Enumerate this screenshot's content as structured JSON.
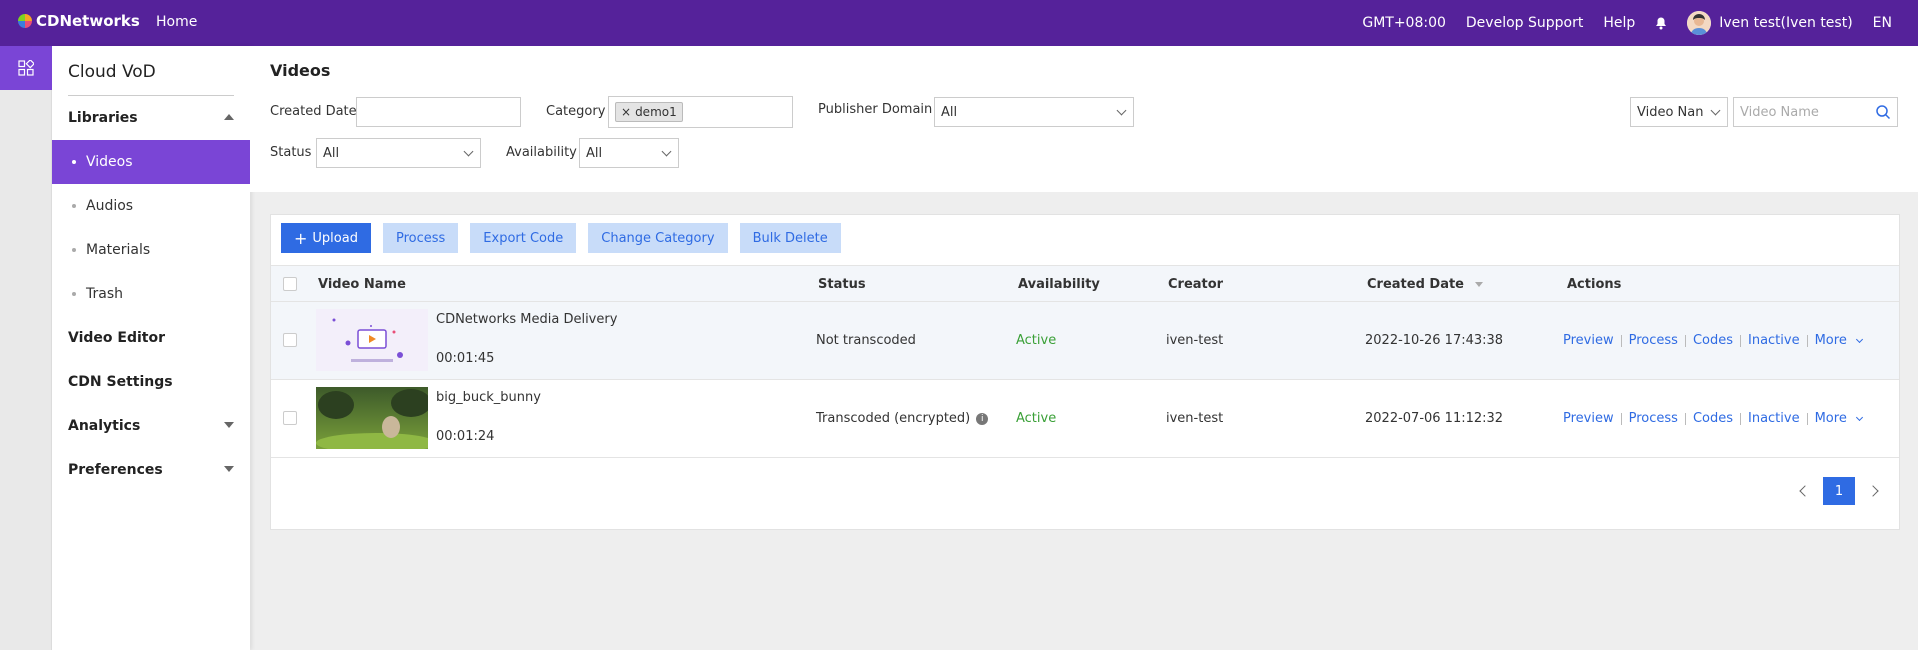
{
  "topbar": {
    "brand": "CDNetworks",
    "home": "Home",
    "timezone": "GMT+08:00",
    "develop_support": "Develop Support",
    "help": "Help",
    "user": "Iven test(Iven test)",
    "lang": "EN"
  },
  "sidebar": {
    "title": "Cloud VoD",
    "libraries": "Libraries",
    "sub_items": [
      "Videos",
      "Audios",
      "Materials",
      "Trash"
    ],
    "video_editor": "Video Editor",
    "cdn_settings": "CDN Settings",
    "analytics": "Analytics",
    "preferences": "Preferences"
  },
  "filters": {
    "title": "Videos",
    "created_date_label": "Created Date",
    "created_date_value": "",
    "category_label": "Category",
    "category_tag": "demo1",
    "publisher_label": "Publisher Domain",
    "publisher_value": "All",
    "status_label": "Status",
    "status_value": "All",
    "availability_label": "Availability",
    "availability_value": "All",
    "search_field": "Video Nan",
    "search_placeholder": "Video Name"
  },
  "toolbar": {
    "upload": "Upload",
    "process": "Process",
    "export_code": "Export Code",
    "change_category": "Change Category",
    "bulk_delete": "Bulk Delete"
  },
  "table": {
    "columns": {
      "name": "Video Name",
      "status": "Status",
      "availability": "Availability",
      "creator": "Creator",
      "created_date": "Created Date",
      "actions": "Actions"
    },
    "rows": [
      {
        "name": "CDNetworks Media Delivery",
        "duration": "00:01:45",
        "status": "Not transcoded",
        "availability": "Active",
        "creator": "iven-test",
        "created_date": "2022-10-26 17:43:38"
      },
      {
        "name": "big_buck_bunny",
        "duration": "00:01:24",
        "status": "Transcoded (encrypted)",
        "availability": "Active",
        "creator": "iven-test",
        "created_date": "2022-07-06 11:12:32"
      }
    ],
    "actions": [
      "Preview",
      "Process",
      "Codes",
      "Inactive",
      "More"
    ]
  },
  "pagination": {
    "current": "1"
  },
  "colors": {
    "topbar": "#55229a",
    "sidebar_active": "#7a45d6",
    "primary": "#2f6be3",
    "active_status": "#3aa037"
  },
  "icons": [
    "apps-icon",
    "bell-icon",
    "avatar-icon",
    "search-icon",
    "info-icon",
    "close-icon"
  ]
}
